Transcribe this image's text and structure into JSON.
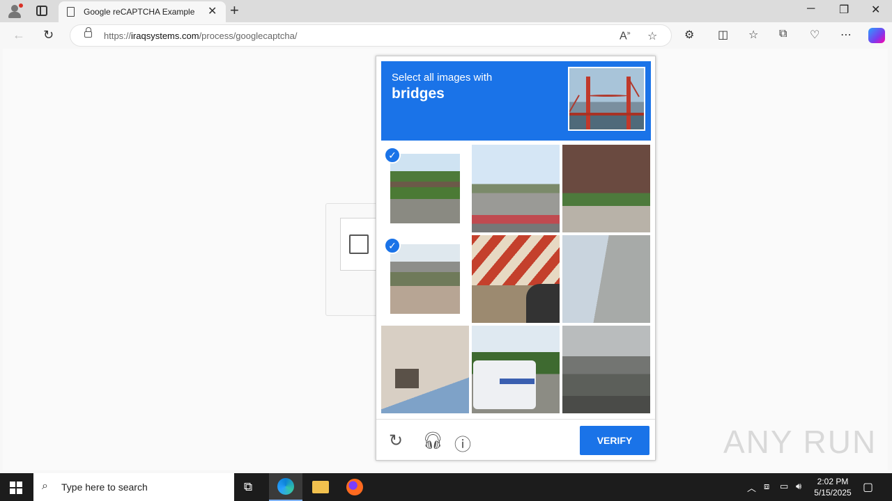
{
  "browser": {
    "tab_title": "Google reCAPTCHA Example",
    "url_prefix": "https://",
    "url_domain": "iraqsystems.com",
    "url_path": "/process/googlecaptcha/"
  },
  "captcha": {
    "instruction_line1": "Select all images with",
    "instruction_target": "bridges",
    "verify_label": "VERIFY",
    "tiles": [
      {
        "subject": "overpass-bridge-road",
        "selected": true
      },
      {
        "subject": "traffic-lights-street",
        "selected": false
      },
      {
        "subject": "brick-house",
        "selected": false
      },
      {
        "subject": "highway-overpass",
        "selected": true
      },
      {
        "subject": "striped-barrier-motorcycle",
        "selected": false
      },
      {
        "subject": "building-wall-wires",
        "selected": false
      },
      {
        "subject": "building-facade",
        "selected": false
      },
      {
        "subject": "bus-street",
        "selected": false
      },
      {
        "subject": "elevated-highway",
        "selected": false
      }
    ]
  },
  "watermark": "ANY RUN",
  "taskbar": {
    "search_placeholder": "Type here to search",
    "time": "2:02 PM",
    "date": "5/15/2025"
  },
  "colors": {
    "accent": "#1a73e8"
  }
}
